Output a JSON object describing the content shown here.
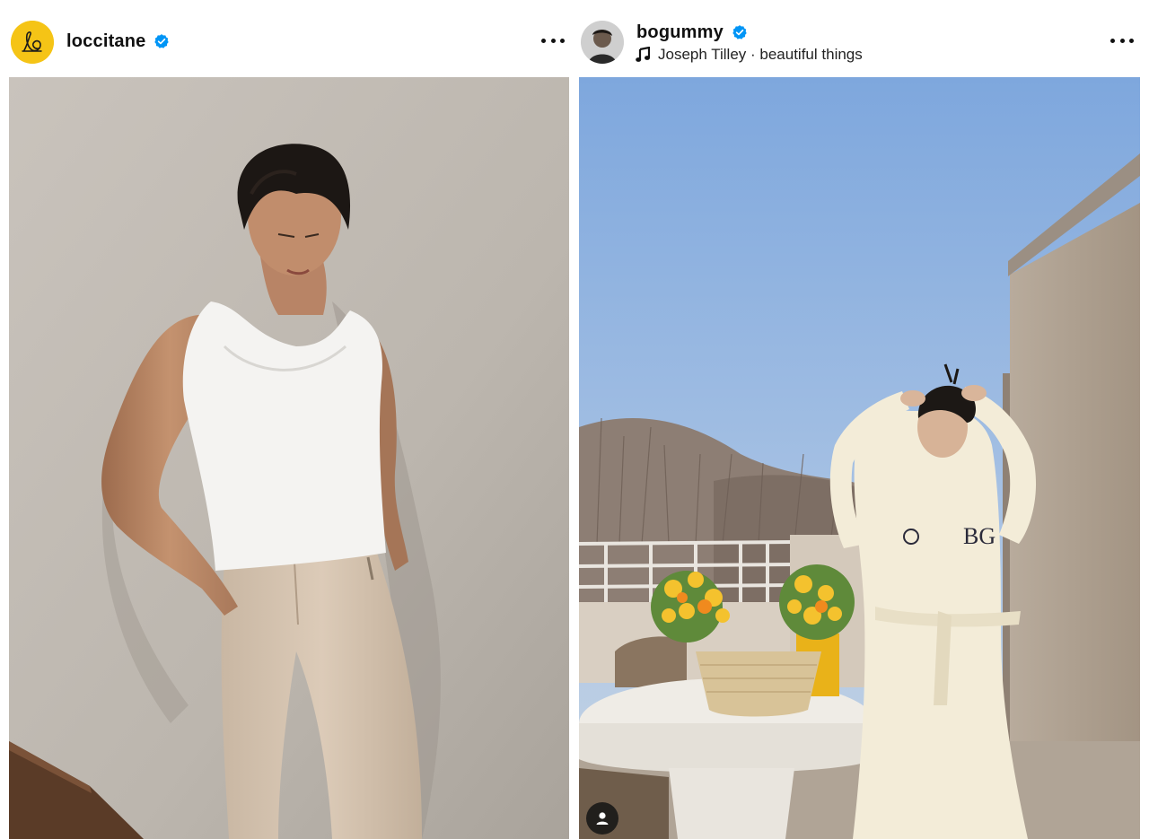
{
  "posts": [
    {
      "username": "loccitane",
      "verified": true,
      "avatar_icon": "loccitane-logo-icon",
      "avatar_color": "#F5C416",
      "more_icon": "more-options-icon",
      "photo_description_icon": "model-portrait-image"
    },
    {
      "username": "bogummy",
      "verified": true,
      "avatar_icon": "profile-photo-icon",
      "music": {
        "artist": "Joseph Tilley",
        "separator": " · ",
        "track": "beautiful things"
      },
      "more_icon": "more-options-icon",
      "robe_monogram": "BG",
      "tagged_icon": "user-tag-icon"
    }
  ],
  "colors": {
    "verified_blue": "#0095F6",
    "text": "#111111"
  }
}
